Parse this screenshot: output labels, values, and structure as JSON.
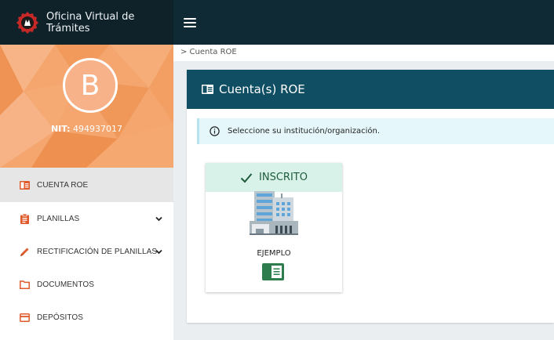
{
  "app": {
    "title": "Oficina Virtual de Trámites"
  },
  "profile": {
    "initial": "B",
    "nit_label": "NIT:",
    "nit_value": "494937017"
  },
  "sidebar": {
    "items": [
      {
        "label": "CUENTA ROE",
        "icon": "card-icon",
        "active": true
      },
      {
        "label": "PLANILLAS",
        "icon": "clipboard-icon",
        "expandable": true
      },
      {
        "label": "RECTIFICACIÓN DE PLANILLAS",
        "icon": "pencil-icon",
        "expandable": true
      },
      {
        "label": "DOCUMENTOS",
        "icon": "folder-icon"
      },
      {
        "label": "DEPÓSITOS",
        "icon": "credit-card-icon"
      }
    ]
  },
  "breadcrumb": {
    "text": "> Cuenta ROE"
  },
  "panel": {
    "title": "Cuenta(s) ROE",
    "info_message": "Seleccione su institución/organización."
  },
  "card": {
    "status": "INSCRITO",
    "name": "EJEMPLO"
  },
  "colors": {
    "topbar": "#0f2a35",
    "panel_header": "#0f4e63",
    "profile_bg": "#f4a66e",
    "accent": "#e05a2b",
    "status_bg": "#d8f2ea",
    "book_green": "#2e7d4f"
  }
}
